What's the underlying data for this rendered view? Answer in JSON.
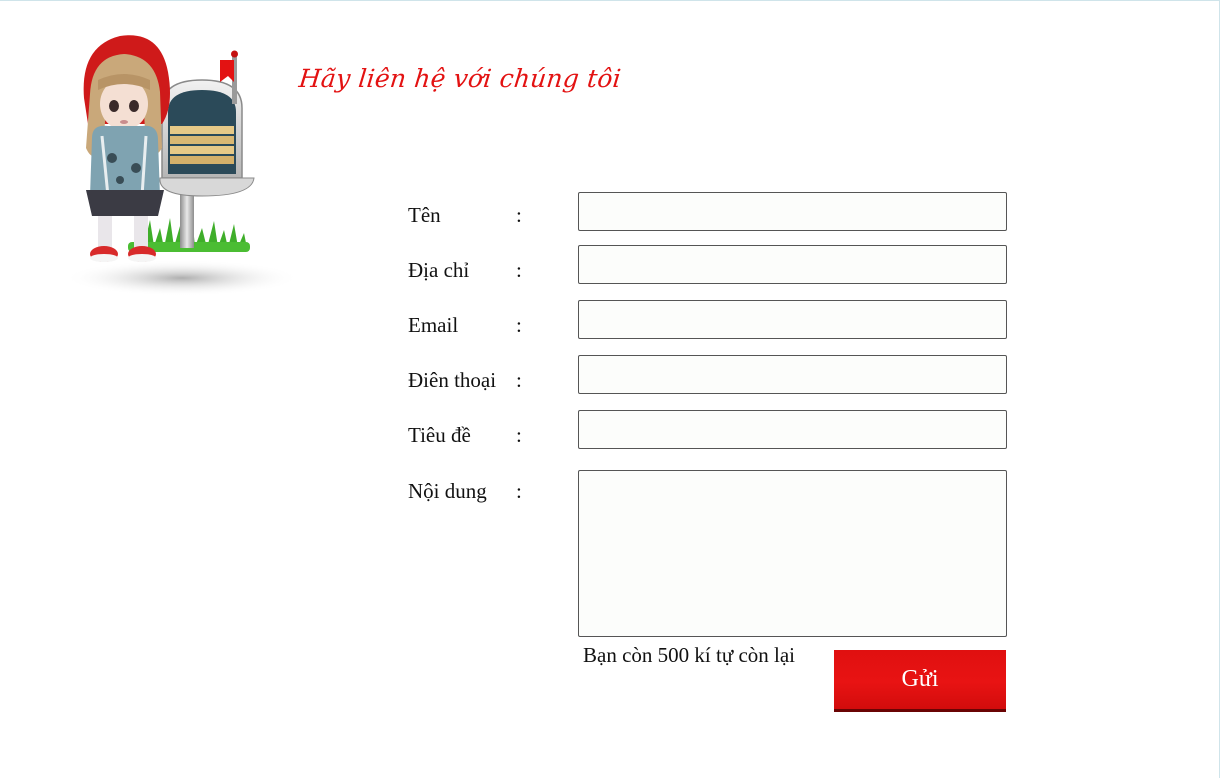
{
  "header": {
    "title": "Hãy liên hệ với chúng tôi"
  },
  "form": {
    "fields": [
      {
        "label": "Tên",
        "colon": ":",
        "value": ""
      },
      {
        "label": "Địa chỉ",
        "colon": ":",
        "value": ""
      },
      {
        "label": "Email",
        "colon": ":",
        "value": ""
      },
      {
        "label": "Điên thoại",
        "colon": ":",
        "value": ""
      },
      {
        "label": "Tiêu đề",
        "colon": ":",
        "value": ""
      },
      {
        "label": "Nội dung",
        "colon": ":",
        "value": ""
      }
    ],
    "char_counter": "Bạn còn 500 kí tự còn lại",
    "submit_label": "Gửi"
  },
  "colors": {
    "accent": "#e31212",
    "button": "#e81313"
  },
  "illustration": {
    "icon": "doll-with-mailbox-illustration"
  }
}
